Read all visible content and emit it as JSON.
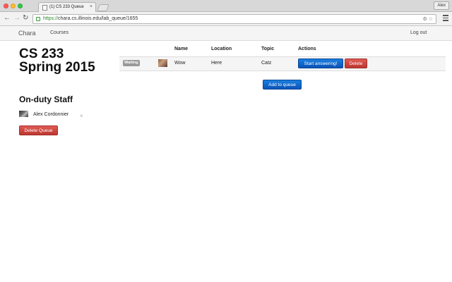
{
  "browser": {
    "tab_title": "(1) CS 233 Queue",
    "tab_close": "×",
    "user_name": "Alex",
    "url_scheme": "https://",
    "url_rest": "chara.cs.illinois.edu/lab_queue/1655"
  },
  "navbar": {
    "brand": "Chara",
    "courses": "Courses",
    "logout": "Log out"
  },
  "sidebar": {
    "title": "CS 233 Spring 2015",
    "staff_heading": "On-duty Staff",
    "staff": [
      {
        "name": "Alex Cordonnier",
        "remove": "×"
      }
    ],
    "delete_queue_label": "Delete Queue"
  },
  "queue": {
    "columns": [
      "",
      "",
      "Name",
      "Location",
      "Topic",
      "Actions"
    ],
    "rows": [
      {
        "status": "Waiting",
        "name": "Wow",
        "location": "Here",
        "topic": "Catz",
        "start_label": "Start answering!",
        "delete_label": "Delete"
      }
    ],
    "add_label": "Add to queue"
  },
  "colors": {
    "primary": "#0a53b8",
    "danger": "#bd362f",
    "status_waiting": "#999999"
  }
}
